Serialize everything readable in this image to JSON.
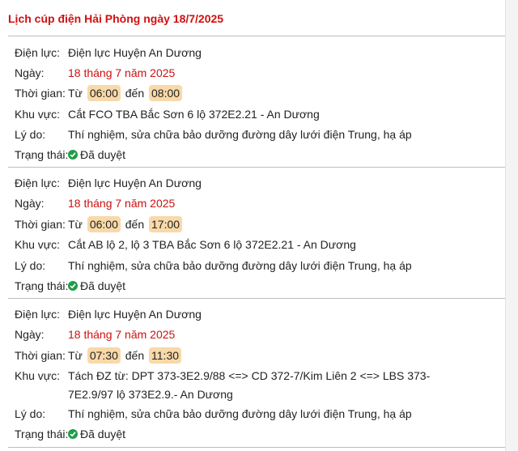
{
  "page_title": "Lịch cúp điện Hải Phòng ngày 18/7/2025",
  "labels": {
    "unit": "Điện lực:",
    "date": "Ngày:",
    "time": "Thời gian:",
    "area": "Khu vực:",
    "reason": "Lý do:",
    "status": "Trạng thái:",
    "from": "Từ",
    "to": "đến"
  },
  "outages": [
    {
      "unit": "Điện lực Huyện An Dương",
      "date": "18 tháng 7 năm 2025",
      "start": "06:00",
      "end": "08:00",
      "area": "Cắt FCO TBA Bắc Sơn 6 lộ 372E2.21 - An Dương",
      "reason": "Thí nghiệm, sửa chữa bảo dưỡng đường dây lưới điện Trung, hạ áp",
      "status": "Đã duyệt"
    },
    {
      "unit": "Điện lực Huyện An Dương",
      "date": "18 tháng 7 năm 2025",
      "start": "06:00",
      "end": "17:00",
      "area": "Cắt AB lộ 2, lộ 3 TBA Bắc Sơn 6 lộ 372E2.21 - An Dương",
      "reason": "Thí nghiệm, sửa chữa bảo dưỡng đường dây lưới điện Trung, hạ áp",
      "status": "Đã duyệt"
    },
    {
      "unit": "Điện lực Huyện An Dương",
      "date": "18 tháng 7 năm 2025",
      "start": "07:30",
      "end": "11:30",
      "area": "Tách ĐZ từ: DPT 373-3E2.9/88 <=> CD 372-7/Kim Liên 2 <=> LBS 373-7E2.9/97 lộ 373E2.9.- An Dương",
      "reason": "Thí nghiệm, sửa chữa bảo dưỡng đường dây lưới điện Trung, hạ áp",
      "status": "Đã duyệt"
    }
  ],
  "colors": {
    "title": "#d01010",
    "date": "#cc1111",
    "time_highlight": "#f8d9a8",
    "status_check": "#1f9d47"
  },
  "icons": {
    "status": "check-circle-icon"
  }
}
